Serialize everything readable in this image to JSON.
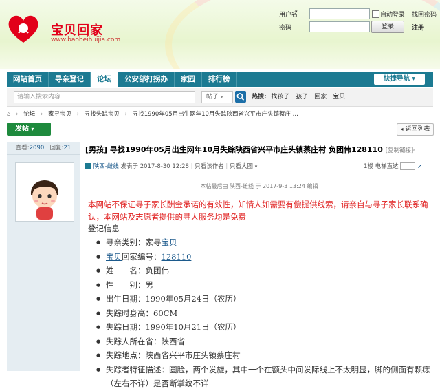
{
  "logo": {
    "name": "宝贝回家",
    "url": "www.baobeihuijia.com"
  },
  "login": {
    "username_label": "用户名",
    "remember_label": "自动登录",
    "find_password": "找回密码",
    "password_label": "密码",
    "login_button": "登录",
    "register_link": "注册"
  },
  "nav": {
    "items": [
      "网站首页",
      "寻亲登记",
      "论坛",
      "公安部打拐办",
      "家园",
      "排行榜"
    ],
    "active": "论坛",
    "quick_nav": "快捷导航"
  },
  "search": {
    "placeholder": "请输入搜索内容",
    "type": "帖子",
    "hot_label": "热搜:",
    "hot_terms": [
      "找孩子",
      "孩子",
      "回家",
      "宝贝"
    ]
  },
  "breadcrumb": [
    "论坛",
    "家寻宝贝",
    "寻找失踪宝贝",
    "寻找1990年05月出生网年10月失踪陕西省兴平市庄头镇蔡庄 ..."
  ],
  "buttons": {
    "post": "发帖",
    "back": "返回列表"
  },
  "stats": {
    "views_label": "查看:",
    "views": "2090",
    "replies_label": "回复:",
    "replies": "21"
  },
  "thread": {
    "title": "[男孩] 寻找1990年05月出生网年10月失踪陕西省兴平市庄头镇蔡庄村 负团伟128110",
    "copy_link": "[复制链接]"
  },
  "post": {
    "author": "陕西-雌线",
    "posted_prefix": "发表于",
    "posted_time": "2017-8-30 12:28",
    "author_only": "只看该作者",
    "view_large": "只看大图",
    "floor": "1楼",
    "direct_label": "电梯直达",
    "edit_note": "本帖最后由 陕西-雌线 于 2017-9-3 13:24 编辑"
  },
  "content": {
    "warning": "本网站不保证寻子家长酬金承诺的有效性，知情人如需要有偿提供线索，请亲自与寻子家长联系确认，本网站及志愿者提供的寻人服务均是免费",
    "reg_title": "登记信息",
    "items": [
      {
        "label": "寻亲类别：家寻",
        "link": "宝贝",
        "suffix": ""
      },
      {
        "label": "",
        "link": "宝贝",
        "suffix": "回家编号：",
        "link2": "128110"
      },
      {
        "label": "姓　　名：负团伟"
      },
      {
        "label": "性　　别：男"
      },
      {
        "label": "出生日期：1990年05月24日（农历）"
      },
      {
        "label": "失踪时身高：60CM"
      },
      {
        "label": "失踪日期：1990年10月21日（农历）"
      },
      {
        "label": "失踪人所在省：陕西省"
      },
      {
        "label": "失踪地点：陕西省兴平市庄头镇蔡庄村"
      },
      {
        "label": "失踪者特征描述：圆脸，两个发旋，其中一个在额头中间发际线上不太明显，脚的侧面有颗痣（左右不详）是否断掌纹不详"
      }
    ]
  },
  "colors": {
    "nav": "#1c7a92",
    "post_button": "#1e8a3d",
    "warning": "#e02020",
    "link": "#1c5a8c",
    "logo": "#e2001a"
  }
}
